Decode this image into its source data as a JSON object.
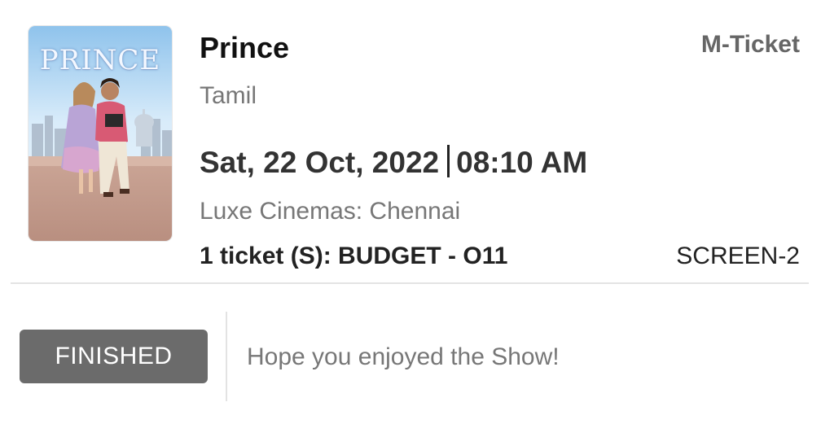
{
  "booking": {
    "poster_title": "PRINCE",
    "movie_title": "Prince",
    "ticket_type": "M-Ticket",
    "language": "Tamil",
    "date": "Sat, 22 Oct, 2022",
    "time": "08:10 AM",
    "venue": "Luxe Cinemas: Chennai",
    "tickets": "1 ticket (S): BUDGET - O11",
    "screen": "SCREEN-2"
  },
  "status": {
    "badge_label": "FINISHED",
    "message": "Hope you enjoyed the Show!"
  },
  "colors": {
    "badge_background": "#6b6b6b",
    "muted_text": "#777777",
    "divider": "#e3e3e3"
  }
}
